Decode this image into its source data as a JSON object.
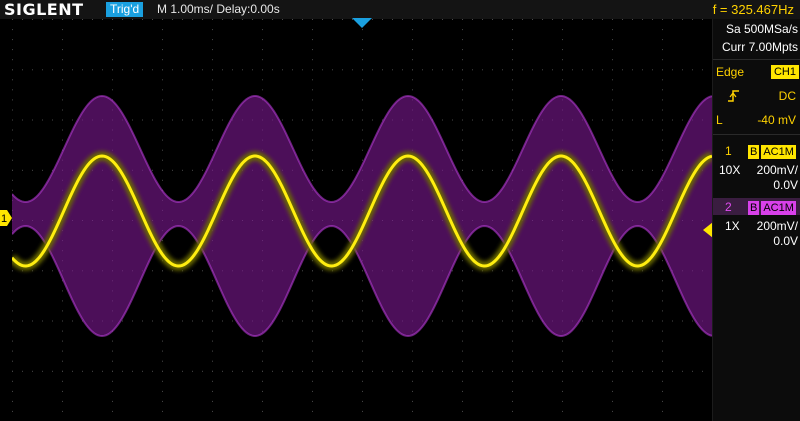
{
  "header": {
    "brand": "SIGLENT",
    "trigger_status": "Trig'd",
    "timebase": "M 1.00ms/ Delay:0.00s",
    "frequency": "f = 325.467Hz"
  },
  "acquisition": {
    "sample_rate": "Sa 500MSa/s",
    "memory_depth": "Curr 7.00Mpts"
  },
  "trigger": {
    "type_label": "Edge",
    "source": "CH1",
    "coupling": "DC",
    "level_label": "L",
    "level_value": "-40 mV"
  },
  "channels": [
    {
      "number": "1",
      "bw_icon": "B",
      "coupling": "AC1M",
      "probe": "10X",
      "vdiv": "200mV/",
      "offset": "0.0V",
      "color": "#ffe600"
    },
    {
      "number": "2",
      "bw_icon": "B",
      "coupling": "AC1M",
      "probe": "1X",
      "vdiv": "200mV/",
      "offset": "0.0V",
      "color": "#d840ea"
    }
  ],
  "markers": {
    "ch1_marker_label": "1",
    "trigger_position_icon": "triangle-down-icon",
    "trigger_level_icon": "triangle-left-icon"
  },
  "colors": {
    "ch1": "#ffe600",
    "ch2": "#b020c8",
    "freq_text": "#ffd200",
    "trig_badge": "#1aa0e0"
  },
  "waveforms": {
    "ch1": {
      "shape": "sine",
      "frequency_hz": 325.467,
      "periods_on_screen": 4.6
    },
    "ch2": {
      "shape": "amplitude-modulated envelope"
    }
  }
}
